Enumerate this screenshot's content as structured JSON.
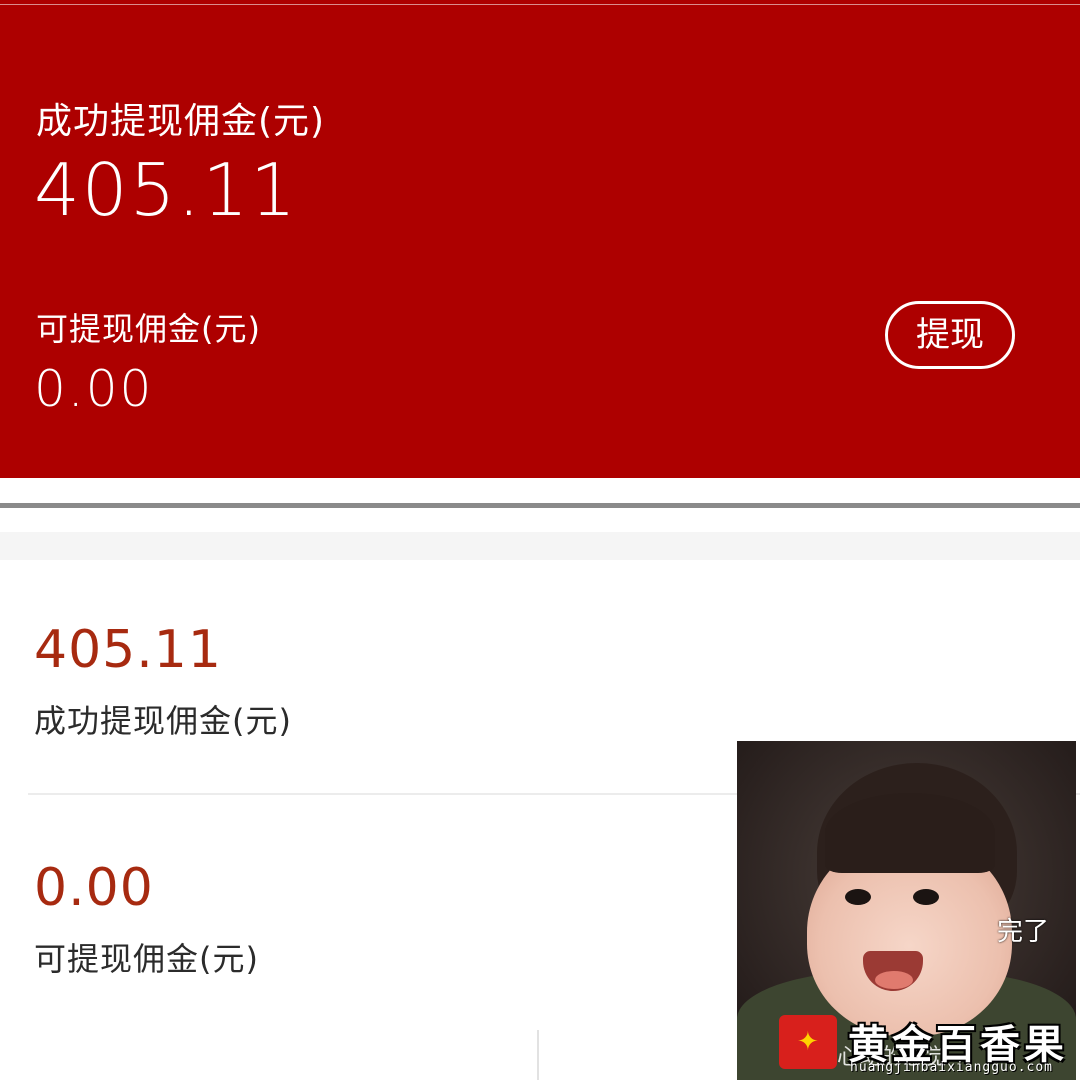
{
  "header_card": {
    "success_label": "成功提现佣金(元)",
    "success_amount": "405.11",
    "available_label": "可提现佣金(元)",
    "available_amount": "0.00",
    "withdraw_button": "提现"
  },
  "stats_list": [
    {
      "amount": "405.11",
      "label": "成功提现佣金(元)"
    },
    {
      "amount": "0.00",
      "label": "可提现佣金(元)"
    }
  ],
  "sticker": {
    "text": "完了",
    "caption": "心动的感觉"
  },
  "watermark": {
    "brand": "黄金百香果",
    "url": "huangjinbaixiangguo.com"
  },
  "colors": {
    "header_bg": "#ad0000",
    "amount_red": "#a72a10"
  }
}
